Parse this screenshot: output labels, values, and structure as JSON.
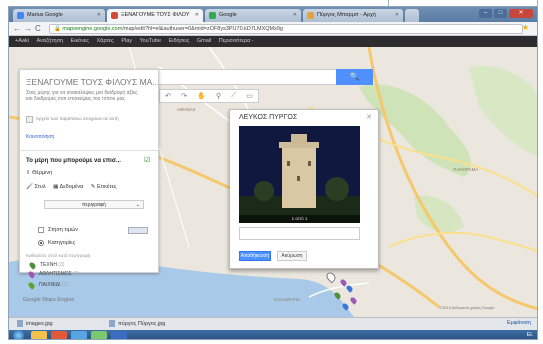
{
  "browser": {
    "tabs": [
      {
        "label": "Marius Google"
      },
      {
        "label": "ΞΕΝΑΓΟΥΜΕ ΤΟΥΣ ΦΙΛΟΥ"
      },
      {
        "label": "Google"
      },
      {
        "label": "Πύργος Μπαρμπ - Αρχή"
      }
    ],
    "url_host": "mapsengine.google.com",
    "url_path": "/map/edit?hl=el&authuser=0&mid=zOF8ys3PU70.kD7LMXQMx9g",
    "gbar_items": [
      "+Aaki",
      "Αναζήτηση",
      "Εικόνες",
      "Χάρτες",
      "Play",
      "YouTube",
      "Ειδήσεις",
      "Gmail",
      "Περισσότερα -"
    ]
  },
  "search": {
    "button_icon": "search-icon"
  },
  "panel": {
    "title": "ΞΕΝΑΓΟΥΜΕ ΤΟΥΣ ΦΙΛΟΥΣ ΜΑ...",
    "description": "Στας μέρης για να ανακαλύψεις μια διαδρομή αξίες και διαδρομές έτσι επισκέψεις του τόπου μας",
    "note": "Αρχείο των παραπάνω στοιχείων σε αυτή",
    "share": "Κοινοποίηση",
    "layer_title": "Το μέρη που μπορούμε να επισ...",
    "import": "Θέρμινη",
    "tools": [
      "Στυλ",
      "Δεδομένα",
      "Ετικέτες"
    ],
    "select_value": "περιγραφή",
    "option1": "Στήση τιμών",
    "option2": "Κατηγορίες",
    "small": "Καθορίστε στυλ κατά περιγραφή",
    "legend": [
      {
        "label": "ΤΕΧΝΗ",
        "count": "(3)",
        "color": "#4e8f3a"
      },
      {
        "label": "ΑΘΛΗΤΙΣΜΟΣ",
        "count": "(3)",
        "color": "#9b59b6"
      },
      {
        "label": "ΠΑΙΧΝΙΔΙ",
        "count": "(3)",
        "color": "#5aa52b"
      }
    ]
  },
  "info": {
    "title": "ΛΕΥΚΟΣ ΠΥΡΓΟΣ",
    "photo_caption": "1 από 1",
    "save": "Αποθήκευση",
    "cancel": "Ακύρωση"
  },
  "map": {
    "labels": [
      "ΑΘΗΝΑΣ",
      "ΠΑΝΟΡΑΜΑ",
      "ΚΑΛΑΜΑΡΙΑ"
    ],
    "credit": "Google Maps Engine",
    "copyright": "©2013 Δεδομένα χάρτη Google"
  },
  "downloads": {
    "items": [
      "images.jpg",
      "πύργος Πύργος.jpg"
    ],
    "show_all": "Εμφάνιση"
  },
  "taskbar": {
    "tray": "EL"
  },
  "colors": {
    "accent": "#4d90fe",
    "map_water": "#a9c9e8",
    "map_land": "#e9e5dc"
  }
}
